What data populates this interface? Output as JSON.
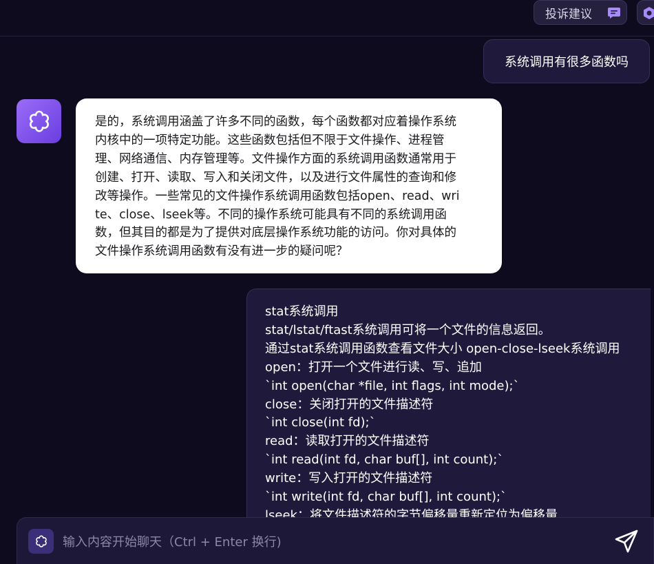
{
  "header": {
    "feedback_label": "投诉建议",
    "feedback_icon": "chat-bubble-icon",
    "settings_icon": "settings-icon"
  },
  "conversation": [
    {
      "role": "user",
      "text": "系统调用有很多函数吗"
    },
    {
      "role": "assistant",
      "lines": [
        "是的，系统调用涵盖了许多不同的函数，每个函数都对应着操作系统",
        "内核中的一项特定功能。这些函数包括但不限于文件操作、进程管",
        "理、网络通信、内存管理等。文件操作方面的系统调用函数通常用于",
        "创建、打开、读取、写入和关闭文件，以及进行文件属性的查询和修",
        "改等操作。一些常见的文件操作系统调用函数包括open、read、wri",
        "te、close、lseek等。不同的操作系统可能具有不同的系统调用函",
        "数，但其目的都是为了提供对底层操作系统功能的访问。你对具体的",
        "文件操作系统调用函数有没有进一步的疑问呢？"
      ]
    },
    {
      "role": "user",
      "lines": [
        "stat系统调用",
        "stat/lstat/ftast系统调用可将一个文件的信息返回。",
        "通过stat系统调用函数查看文件大小 open-close-lseek系统调用",
        "open：打开一个文件进行读、写、追加",
        "`int open(char *file, int flags, int mode);`",
        "close：关闭打开的文件描述符",
        "`int close(int fd);`",
        "read：读取打开的文件描述符",
        "`int read(int fd, char buf[], int count);`",
        "write：写入打开的文件描述符",
        "`int write(int fd, char buf[], int count);`",
        "lseek：将文件描述符的字节偏移量重新定位为偏移量"
      ]
    }
  ],
  "composer": {
    "placeholder": "输入内容开始聊天（Ctrl + Enter 换行)",
    "value": "",
    "send_icon": "send-icon",
    "bot_icon": "bot-icon"
  },
  "colors": {
    "background": "#0e0b1f",
    "user_bubble": "#1f1a3c",
    "assistant_bubble": "#ffffff",
    "accent": "#8b5cf6"
  }
}
